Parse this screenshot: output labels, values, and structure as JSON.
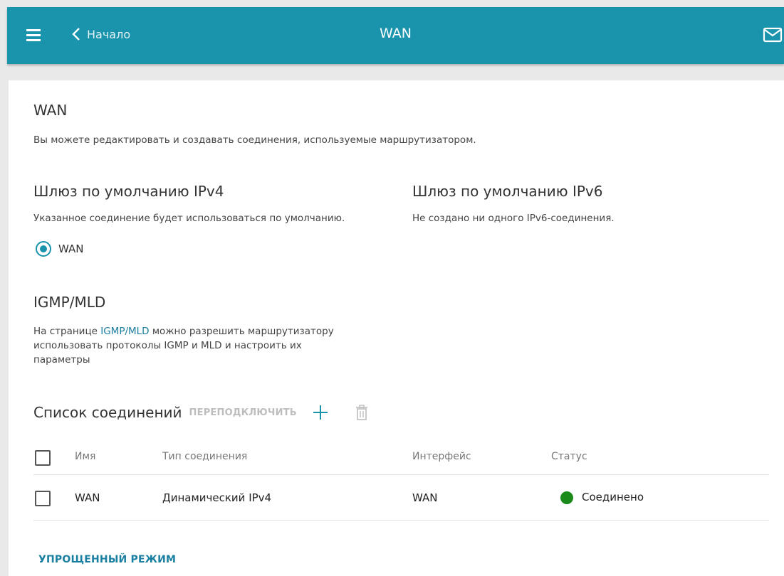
{
  "header": {
    "back_label": "Начало",
    "title": "WAN",
    "menu_icon": "hamburger-icon",
    "back_icon": "chevron-left-icon",
    "mail_icon": "mail-icon",
    "bg_color": "#1a93ad"
  },
  "wan": {
    "heading": "WAN",
    "description": "Вы можете редактировать и создавать соединения, используемые маршрутизатором."
  },
  "gateway_ipv4": {
    "heading": "Шлюз по умолчанию IPv4",
    "description": "Указанное соединение будет использоваться по умолчанию.",
    "option_label": "WAN",
    "option_selected": true
  },
  "gateway_ipv6": {
    "heading": "Шлюз по умолчанию IPv6",
    "description": "Не создано ни одного IPv6-соединения."
  },
  "igmp": {
    "heading": "IGMP/MLD",
    "text_before": "На странице ",
    "link_text": "IGMP/MLD",
    "text_after_line1": " можно разрешить маршрутизатору",
    "text_line2": "использовать протоколы IGMP и MLD и настроить их",
    "text_line3": "параметры"
  },
  "connections": {
    "title": "Список соединений",
    "reconnect_label": "ПЕРЕПОДКЛЮЧИТЬ",
    "add_icon": "plus-icon",
    "delete_icon": "trash-icon",
    "columns": {
      "name": "Имя",
      "type": "Тип соединения",
      "interface": "Интерфейс",
      "status": "Статус"
    },
    "rows": [
      {
        "name": "WAN",
        "type": "Динамический IPv4",
        "interface": "WAN",
        "status": "Соединено",
        "status_color": "#1a8a1a"
      }
    ]
  },
  "footer": {
    "simple_mode_label": "УПРОЩЕННЫЙ РЕЖИМ"
  }
}
